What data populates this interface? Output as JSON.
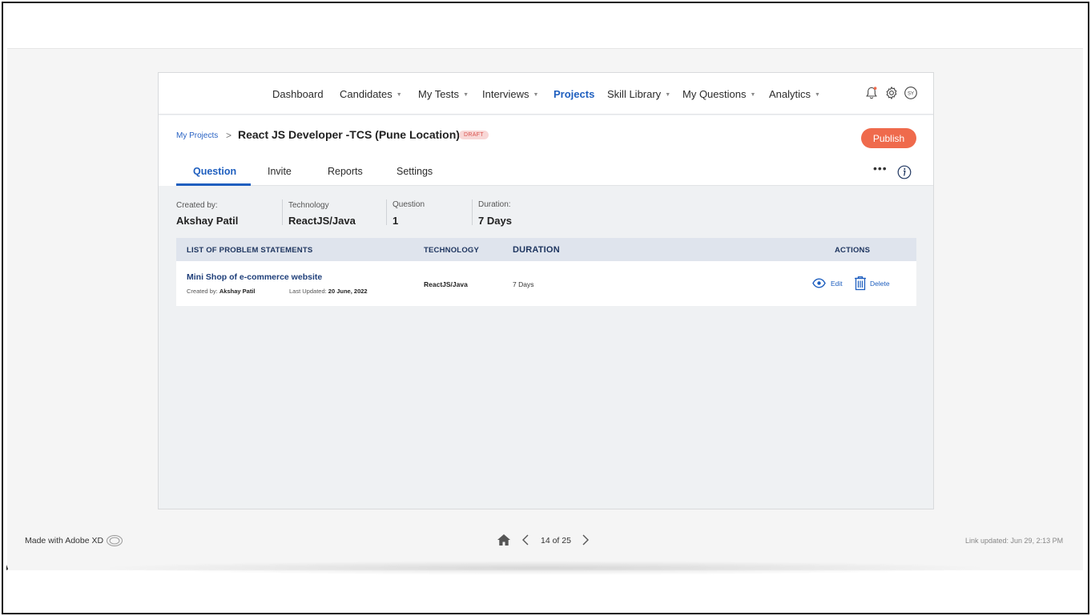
{
  "nav": {
    "items": [
      {
        "label": "Dashboard",
        "caret": false
      },
      {
        "label": "Candidates",
        "caret": true
      },
      {
        "label": "My Tests",
        "caret": true
      },
      {
        "label": "Interviews",
        "caret": true
      },
      {
        "label": "Projects",
        "caret": false,
        "active": true
      },
      {
        "label": "Skill Library",
        "caret": true
      },
      {
        "label": "My Questions",
        "caret": true
      },
      {
        "label": "Analytics",
        "caret": true
      }
    ],
    "caret_glyph": "▼",
    "icons": [
      "bell-icon",
      "gear-icon",
      "avatar"
    ],
    "avatar_initials": "SY",
    "accent_color": "#1f5fbf"
  },
  "header": {
    "breadcrumb_link": "My Projects",
    "breadcrumb_sep": ">",
    "title": "React JS  Developer -TCS (Pune Location)",
    "badge": "DRAFT",
    "publish_label": "Publish",
    "publish_color": "#ef6a4c"
  },
  "tabs": [
    {
      "label": "Question",
      "active": true
    },
    {
      "label": "Invite"
    },
    {
      "label": "Reports"
    },
    {
      "label": "Settings"
    }
  ],
  "more_dots": "•••",
  "meta": {
    "created_by_label": "Created by:",
    "created_by_value": "Akshay Patil",
    "technology_label": "Technology",
    "technology_value": "ReactJS/Java",
    "question_label": "Question",
    "question_value": "1",
    "duration_label": "Duration:",
    "duration_value": "7 Days"
  },
  "table": {
    "headers": {
      "problem": "LIST OF PROBLEM STATEMENTS",
      "technology": "TECHNOLOGY",
      "duration": "DURATION",
      "actions": "ACTIONS"
    },
    "rows": [
      {
        "title": "Mini Shop of e-commerce website",
        "created_by_label": "Created by:",
        "created_by": "Akshay Patil",
        "updated_label": "Last Updated:",
        "updated": "20 June, 2022",
        "technology": "ReactJS/Java",
        "duration": "7 Days",
        "edit_label": "Edit",
        "delete_label": "Delete"
      }
    ]
  },
  "footer": {
    "made_with": "Made with Adobe XD",
    "page_count": "14 of 25",
    "link_updated": "Link updated: Jun 29, 2:13 PM"
  }
}
